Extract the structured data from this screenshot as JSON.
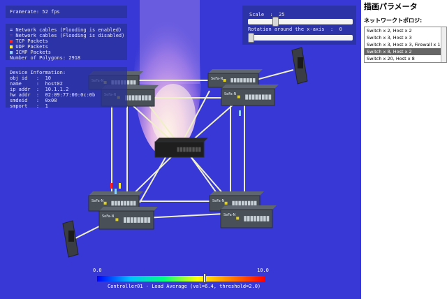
{
  "hud": {
    "framerate": "Framerate: 52 fps",
    "legend": [
      {
        "swatch": "=",
        "text": " Network cables (Flooding is enabled)",
        "color": "#ffffff"
      },
      {
        "swatch": "=",
        "text": " Network cables (Flooding is disabled)",
        "color": "#ff2020"
      },
      {
        "swatch": "■",
        "text": " TCP Packets",
        "color": "#ff2020"
      },
      {
        "swatch": "■",
        "text": " UDP Packets",
        "color": "#ffee33"
      },
      {
        "swatch": "■",
        "text": " ICMP Packets",
        "color": "#8fd0ff"
      }
    ],
    "polygons": "Number of Polygons: 2918",
    "device_info": {
      "heading": "Device Information:",
      "lines": [
        "obj id   :  10",
        "name     :  host02",
        "ip addr  :  10.1.1.2",
        "hw addr  :  02:09:77:00:0c:0b",
        "smdeid   :  0x08",
        "smport   :  1"
      ]
    }
  },
  "controls": {
    "scale_label": "Scale  :  25",
    "scale_value": 0.25,
    "rotation_label": "Rotation around the x-axis  :  0",
    "rotation_value": 0.0
  },
  "load_bar": {
    "min_label": "0.0",
    "max_label": "10.0",
    "caption": "Controller01 - Load Average (val=6.4, threshold=2.0)",
    "value": 6.4,
    "max": 10.0
  },
  "sidebar": {
    "title": "描画パラメータ",
    "topology_label": "ネットワークトポロジ:",
    "topologies": [
      "Switch x 2, Host x 2",
      "Switch x 3, Host x 3",
      "Switch x 3, Host x 3, Firewall x 1",
      "Switch x 8, Host x 2",
      "Switch x 20, Host x 8"
    ],
    "selected_index": 3
  },
  "scene": {
    "switch_brand": "SeFa-N",
    "cable_color": "#f0f0c8"
  }
}
